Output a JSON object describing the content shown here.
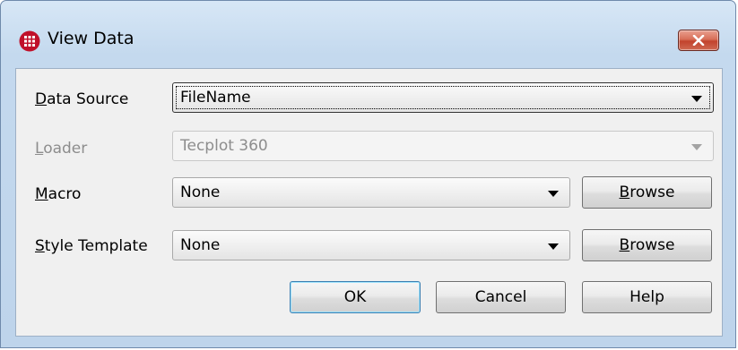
{
  "window": {
    "title": "View Data"
  },
  "form": {
    "data_source": {
      "label_accel": "D",
      "label_rest": "ata Source",
      "value": "FileName"
    },
    "loader": {
      "label_accel": "L",
      "label_rest": "oader",
      "value": "Tecplot 360"
    },
    "macro": {
      "label_accel": "M",
      "label_rest": "acro",
      "value": "None"
    },
    "style_template": {
      "label_accel": "S",
      "label_rest": "tyle Template",
      "value": "None"
    }
  },
  "buttons": {
    "browse_accel": "B",
    "browse_rest": "rowse",
    "ok": "OK",
    "cancel": "Cancel",
    "help": "Help"
  },
  "colors": {
    "frame": "#c4d9ee",
    "client": "#f0f0f0",
    "close": "#c2432c",
    "default_button_border": "#3c7fb1"
  },
  "icons": [
    "app-grid-icon",
    "close-icon",
    "chevron-down-icon"
  ]
}
